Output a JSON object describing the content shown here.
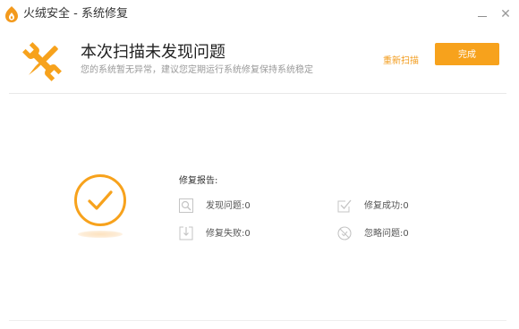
{
  "window": {
    "title": "火绒安全 - 系统修复",
    "minimize_icon": "minimize-icon",
    "close_icon": "close-icon",
    "close_glyph": "✕"
  },
  "header": {
    "icon": "tools-icon",
    "title": "本次扫描未发现问题",
    "subtitle": "您的系统暂无异常，建议您定期运行系统修复保持系统稳定",
    "rescan_label": "重新扫描",
    "done_label": "完成"
  },
  "report": {
    "title": "修复报告:",
    "items": [
      {
        "icon": "magnifier-icon",
        "label": "发现问题:0"
      },
      {
        "icon": "checkbox-icon",
        "label": "修复成功:0"
      },
      {
        "icon": "download-icon",
        "label": "修复失败:0"
      },
      {
        "icon": "ignore-icon",
        "label": "忽略问题:0"
      }
    ]
  },
  "colors": {
    "accent": "#f7a21c",
    "accent_text": "#f29b1b",
    "icon_gray": "#c4c4c4"
  }
}
